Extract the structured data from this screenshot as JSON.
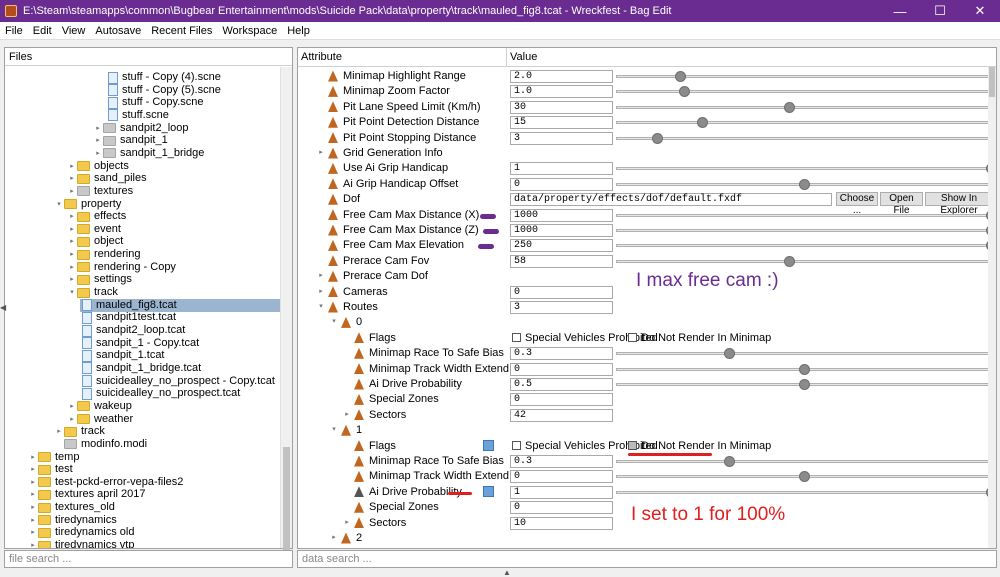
{
  "window": {
    "title": "E:\\Steam\\steamapps\\common\\Bugbear Entertainment\\mods\\Suicide Pack\\data\\property\\track\\mauled_fig8.tcat - Wreckfest - Bag Edit",
    "min": "—",
    "max": "☐",
    "close": "✕"
  },
  "menu": [
    "File",
    "Edit",
    "View",
    "Autosave",
    "Recent Files",
    "Workspace",
    "Help"
  ],
  "files": {
    "header": "Files",
    "search_placeholder": "file search ...",
    "tree": [
      {
        "label": "stuff - Copy (4).scne",
        "type": "file",
        "indent": 7
      },
      {
        "label": "stuff - Copy (5).scne",
        "type": "file",
        "indent": 7
      },
      {
        "label": "stuff - Copy.scne",
        "type": "file",
        "indent": 7
      },
      {
        "label": "stuff.scne",
        "type": "file",
        "indent": 7
      },
      {
        "label": "sandpit2_loop",
        "type": "grey",
        "indent": 6
      },
      {
        "label": "sandpit_1",
        "type": "grey",
        "indent": 6
      },
      {
        "label": "sandpit_1_bridge",
        "type": "grey",
        "indent": 6
      },
      {
        "label": "objects",
        "type": "folder",
        "indent": 4
      },
      {
        "label": "sand_piles",
        "type": "folder",
        "indent": 4
      },
      {
        "label": "textures",
        "type": "grey",
        "indent": 4
      },
      {
        "label": "property",
        "type": "folder",
        "indent": 3,
        "open": true
      },
      {
        "label": "effects",
        "type": "folder",
        "indent": 4
      },
      {
        "label": "event",
        "type": "folder",
        "indent": 4
      },
      {
        "label": "object",
        "type": "folder",
        "indent": 4
      },
      {
        "label": "rendering",
        "type": "folder",
        "indent": 4
      },
      {
        "label": "rendering - Copy",
        "type": "folder",
        "indent": 4
      },
      {
        "label": "settings",
        "type": "folder",
        "indent": 4
      },
      {
        "label": "track",
        "type": "folder",
        "indent": 4,
        "open": true
      },
      {
        "label": "mauled_fig8.tcat",
        "type": "file",
        "indent": 5,
        "selected": true
      },
      {
        "label": "sandpit1test.tcat",
        "type": "file",
        "indent": 5
      },
      {
        "label": "sandpit2_loop.tcat",
        "type": "file",
        "indent": 5
      },
      {
        "label": "sandpit_1 - Copy.tcat",
        "type": "file",
        "indent": 5
      },
      {
        "label": "sandpit_1.tcat",
        "type": "file",
        "indent": 5
      },
      {
        "label": "sandpit_1_bridge.tcat",
        "type": "file",
        "indent": 5
      },
      {
        "label": "suicidealley_no_prospect - Copy.tcat",
        "type": "file",
        "indent": 5
      },
      {
        "label": "suicidealley_no_prospect.tcat",
        "type": "file",
        "indent": 5
      },
      {
        "label": "wakeup",
        "type": "folder",
        "indent": 4
      },
      {
        "label": "weather",
        "type": "folder",
        "indent": 4
      },
      {
        "label": "track",
        "type": "folder",
        "indent": 3
      },
      {
        "label": "modinfo.modi",
        "type": "grey",
        "indent": 3,
        "noTri": true
      },
      {
        "label": "temp",
        "type": "folder",
        "indent": 1
      },
      {
        "label": "test",
        "type": "folder",
        "indent": 1
      },
      {
        "label": "test-pckd-error-vepa-files2",
        "type": "folder",
        "indent": 1
      },
      {
        "label": "textures april 2017",
        "type": "folder",
        "indent": 1
      },
      {
        "label": "textures_old",
        "type": "folder",
        "indent": 1
      },
      {
        "label": "tiredynamics",
        "type": "folder",
        "indent": 1
      },
      {
        "label": "tiredynamics old",
        "type": "folder",
        "indent": 1
      },
      {
        "label": "tiredynamics vtp",
        "type": "folder",
        "indent": 1
      }
    ]
  },
  "attr": {
    "col_attribute": "Attribute",
    "col_value": "Value",
    "search_placeholder": "data search ...",
    "rows": [
      {
        "label": "Minimap Highlight Range",
        "value": "2.0",
        "slider": 0.17,
        "indent": 0
      },
      {
        "label": "Minimap Zoom Factor",
        "value": "1.0",
        "slider": 0.18,
        "indent": 0
      },
      {
        "label": "Pit Lane Speed Limit (Km/h)",
        "value": "30",
        "slider": 0.46,
        "indent": 0
      },
      {
        "label": "Pit Point Detection Distance",
        "value": "15",
        "slider": 0.23,
        "indent": 0
      },
      {
        "label": "Pit Point Stopping Distance",
        "value": "3",
        "slider": 0.11,
        "indent": 0
      },
      {
        "label": "Grid Generation Info",
        "indent": 0,
        "tri": true
      },
      {
        "label": "Use Ai Grip Handicap",
        "value": "1",
        "slider": 1.0,
        "indent": 0
      },
      {
        "label": "Ai Grip Handicap Offset",
        "value": "0",
        "slider": 0.5,
        "indent": 0
      },
      {
        "label": "Dof",
        "value": "data/property/effects/dof/default.fxdf",
        "wide": true,
        "buttons": [
          "Choose ...",
          "Open File",
          "Show In Explorer"
        ],
        "indent": 0
      },
      {
        "label": "Free Cam Max Distance (X)",
        "value": "1000",
        "slider": 1.0,
        "indent": 0
      },
      {
        "label": "Free Cam Max Distance (Z)",
        "value": "1000",
        "slider": 1.0,
        "indent": 0
      },
      {
        "label": "Free Cam Max Elevation",
        "value": "250",
        "slider": 1.0,
        "indent": 0
      },
      {
        "label": "Prerace Cam Fov",
        "value": "58",
        "slider": 0.46,
        "indent": 0
      },
      {
        "label": "Prerace Cam Dof",
        "indent": 0,
        "tri": true
      },
      {
        "label": "Cameras",
        "value": "0",
        "indent": 0,
        "tri": true
      },
      {
        "label": "Routes",
        "value": "3",
        "indent": 0,
        "tri": true,
        "open": true
      },
      {
        "label": "0",
        "indent": 1,
        "tri": true,
        "open": true
      },
      {
        "label": "Flags",
        "indent": 2,
        "flags": [
          "Special Vehicles Prohibited",
          "Do Not Render In Minimap"
        ]
      },
      {
        "label": "Minimap Race To Safe Bias",
        "value": "0.3",
        "slider": 0.3,
        "indent": 2
      },
      {
        "label": "Minimap Track Width Extend",
        "value": "0",
        "slider": 0.5,
        "indent": 2
      },
      {
        "label": "Ai Drive Probability",
        "value": "0.5",
        "slider": 0.5,
        "indent": 2
      },
      {
        "label": "Special Zones",
        "value": "0",
        "indent": 2
      },
      {
        "label": "Sectors",
        "value": "42",
        "indent": 2,
        "tri": true
      },
      {
        "label": "1",
        "indent": 1,
        "tri": true,
        "open": true
      },
      {
        "label": "Flags",
        "indent": 2,
        "flags": [
          "Special Vehicles Prohibited",
          "Do Not Render In Minimap"
        ],
        "save": true,
        "greyCb": true
      },
      {
        "label": "Minimap Race To Safe Bias",
        "value": "0.3",
        "slider": 0.3,
        "indent": 2
      },
      {
        "label": "Minimap Track Width Extend",
        "value": "0",
        "slider": 0.5,
        "indent": 2
      },
      {
        "label": "Ai Drive Probability",
        "value": "1",
        "slider": 1.0,
        "indent": 2,
        "save": true,
        "dark": true
      },
      {
        "label": "Special Zones",
        "value": "0",
        "indent": 2
      },
      {
        "label": "Sectors",
        "value": "10",
        "indent": 2,
        "tri": true
      },
      {
        "label": "2",
        "indent": 1,
        "tri": true
      }
    ]
  },
  "annotations": {
    "purple_text": "I max free cam :)",
    "red_text": "I set to 1 for 100%"
  },
  "colors": {
    "titlebar": "#6a2c91",
    "annotation_purple": "#6a2c91",
    "annotation_red": "#e11d1d"
  }
}
